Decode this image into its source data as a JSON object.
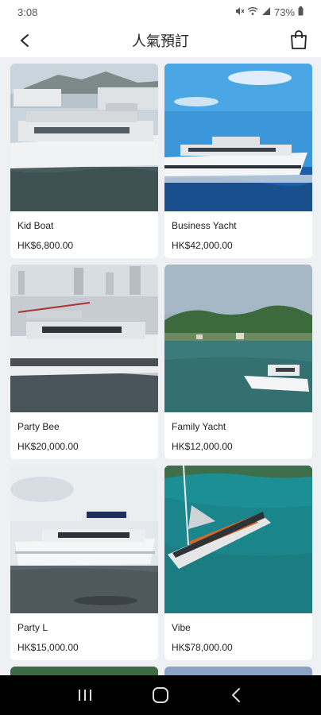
{
  "status": {
    "time": "3:08",
    "battery": "73%",
    "icons": [
      "mute-icon",
      "wifi-icon",
      "signal-icon",
      "battery-icon"
    ]
  },
  "header": {
    "title": "人氣預訂",
    "back_icon": "back-arrow-icon",
    "cart_icon": "shopping-bag-icon"
  },
  "products": [
    {
      "name": "Kid Boat",
      "price": "HK$6,800.00"
    },
    {
      "name": "Business Yacht",
      "price": "HK$42,000.00"
    },
    {
      "name": "Party Bee",
      "price": "HK$20,000.00"
    },
    {
      "name": "Family Yacht",
      "price": "HK$12,000.00"
    },
    {
      "name": "Party L",
      "price": "HK$15,000.00"
    },
    {
      "name": "Vibe",
      "price": "HK$78,000.00"
    }
  ],
  "nav": {
    "icons": [
      "recent-apps-icon",
      "home-icon",
      "back-icon"
    ]
  },
  "colors": {
    "background": "#eef0f4",
    "card": "#ffffff",
    "text": "#222222",
    "nav_bar": "#000000"
  }
}
